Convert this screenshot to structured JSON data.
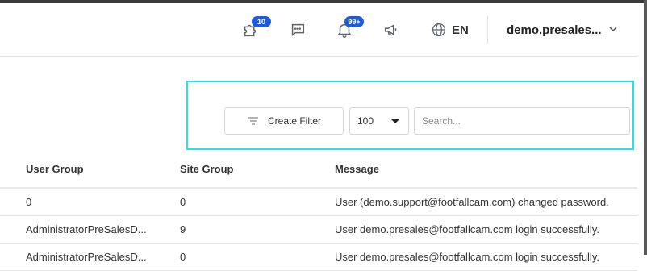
{
  "header": {
    "notifications": [
      {
        "icon": "update-icon",
        "badge": "10"
      },
      {
        "icon": "chat-icon",
        "badge": ""
      },
      {
        "icon": "bell-icon",
        "badge": "99+"
      },
      {
        "icon": "megaphone-icon",
        "badge": ""
      }
    ],
    "language": "EN",
    "user": "demo.presales..."
  },
  "toolbar": {
    "filter_label": "Create Filter",
    "page_size": "100",
    "search_placeholder": "Search..."
  },
  "table": {
    "columns": [
      "User Group",
      "Site Group",
      "Message"
    ],
    "rows": [
      [
        "0",
        "0",
        "User (demo.support@footfallcam.com) changed password."
      ],
      [
        "AdministratorPreSalesD...",
        "9",
        "User demo.presales@footfallcam.com login successfully."
      ],
      [
        "AdministratorPreSalesD...",
        "0",
        "User demo.presales@footfallcam.com login successfully."
      ]
    ]
  },
  "colors": {
    "accent": "#1e5bd8",
    "highlight": "#22e1e8"
  }
}
